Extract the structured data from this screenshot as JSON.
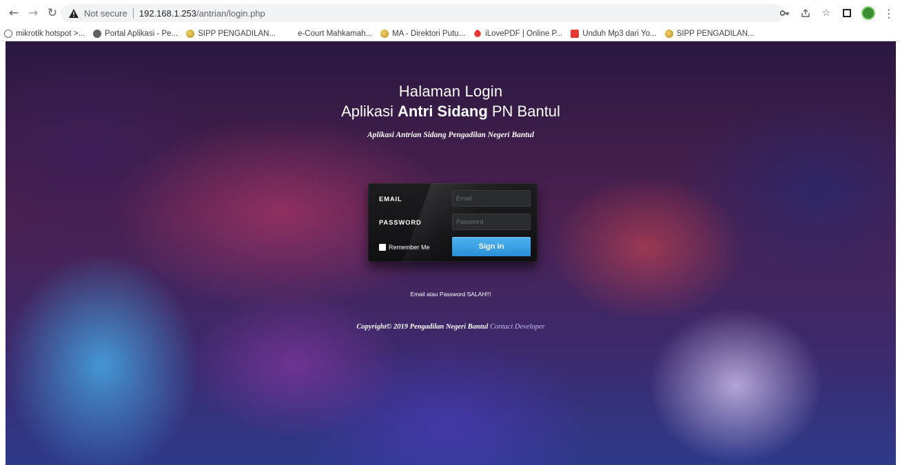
{
  "browser": {
    "security_label": "Not secure",
    "url_host": "192.168.1.253",
    "url_path": "/antrian/login.php",
    "icons": [
      "back-arrow-icon",
      "forward-arrow-icon",
      "reload-icon",
      "warning-icon",
      "key-icon",
      "share-icon",
      "star-icon",
      "sidebar-icon",
      "profile-icon",
      "menu-icon"
    ]
  },
  "bookmarks": [
    {
      "label": "mikrotik hotspot >...",
      "icon": "gray"
    },
    {
      "label": "Portal Aplikasi - Pe...",
      "icon": "globe"
    },
    {
      "label": "SIPP PENGADILAN...",
      "icon": "gold"
    },
    {
      "label": "e-Court Mahkamah...",
      "icon": "none"
    },
    {
      "label": "MA - Direktori Putu...",
      "icon": "gold"
    },
    {
      "label": "iLovePDF | Online P...",
      "icon": "heart"
    },
    {
      "label": "Unduh Mp3 dari Yo...",
      "icon": "red"
    },
    {
      "label": "SIPP PENGADILAN...",
      "icon": "gold"
    }
  ],
  "header": {
    "title_line1": "Halaman Login",
    "title_prefix": "Aplikasi ",
    "title_bold": "Antri Sidang",
    "title_suffix": " PN Bantul",
    "subtitle": "Aplikasi Antrian Sidang Pengadilan Negeri Bantul"
  },
  "login": {
    "email_label": "EMAIL",
    "email_placeholder": "Email",
    "email_value": "",
    "password_label": "PASSWORD",
    "password_placeholder": "Password",
    "password_value": "",
    "remember_label": "Remember Me",
    "remember_checked": false,
    "signin_label": "Sign in"
  },
  "error_message": "Email atau Password SALAH!!!",
  "footer": {
    "copyright": "Copyright© 2019 Pengadilan Negeri Bantul ",
    "contact_link": "Contact Developer"
  }
}
